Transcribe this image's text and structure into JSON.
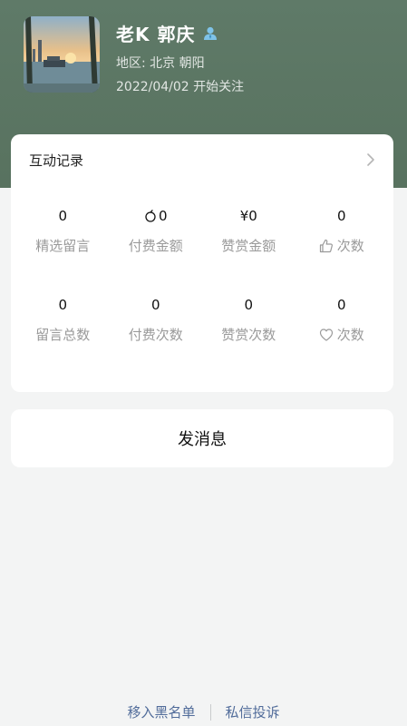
{
  "profile": {
    "name": "老K 郭庆",
    "region": "地区: 北京 朝阳",
    "follow_since": "2022/04/02 开始关注"
  },
  "interaction": {
    "title": "互动记录",
    "stats": [
      {
        "value": "0",
        "label": "精选留言",
        "value_icon": "",
        "label_icon": ""
      },
      {
        "value": "0",
        "label": "付费金额",
        "value_icon": "coin-icon",
        "label_icon": ""
      },
      {
        "value": "¥0",
        "label": "赞赏金额",
        "value_icon": "",
        "label_icon": ""
      },
      {
        "value": "0",
        "label": "次数",
        "value_icon": "",
        "label_icon": "thumbs-up-icon"
      },
      {
        "value": "0",
        "label": "留言总数",
        "value_icon": "",
        "label_icon": ""
      },
      {
        "value": "0",
        "label": "付费次数",
        "value_icon": "",
        "label_icon": ""
      },
      {
        "value": "0",
        "label": "赞赏次数",
        "value_icon": "",
        "label_icon": ""
      },
      {
        "value": "0",
        "label": "次数",
        "value_icon": "",
        "label_icon": "heart-icon"
      }
    ]
  },
  "actions": {
    "send_message": "发消息"
  },
  "footer": {
    "blacklist": "移入黑名单",
    "report": "私信投诉"
  }
}
